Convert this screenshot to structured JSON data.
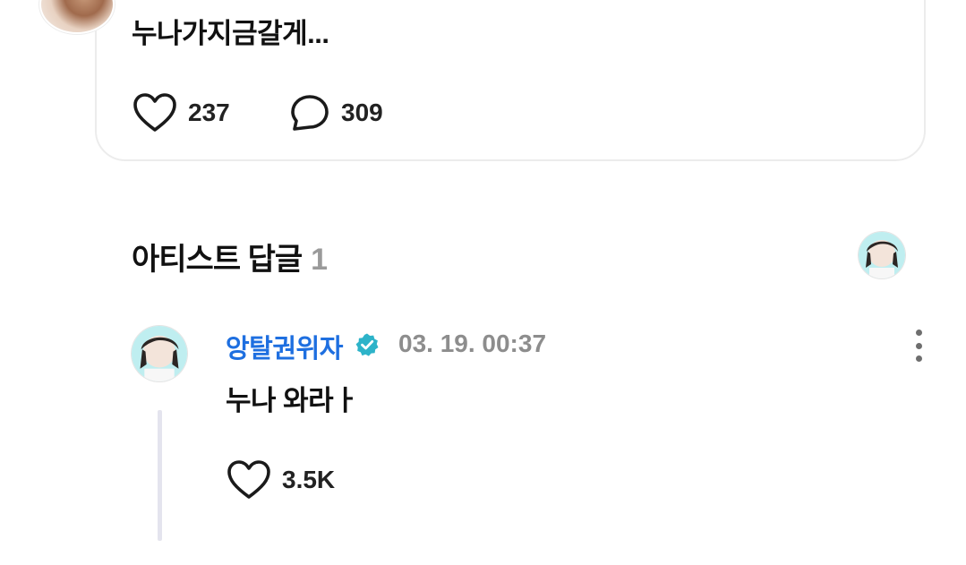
{
  "post": {
    "text": "누나가지금갈게...",
    "likes": "237",
    "comments": "309"
  },
  "artist_replies": {
    "title": "아티스트 답글",
    "count": "1"
  },
  "reply": {
    "author": "앙탈권위자",
    "time": "03. 19. 00:37",
    "text": "누나 와라ㅏ",
    "likes": "3.5K"
  },
  "colors": {
    "author_link": "#1e6fe0",
    "verified_badge": "#2db3c9",
    "muted": "#8d8d8d"
  },
  "icons": [
    "heart-icon",
    "comment-bubble-icon",
    "verified-icon",
    "more-vertical-icon"
  ]
}
